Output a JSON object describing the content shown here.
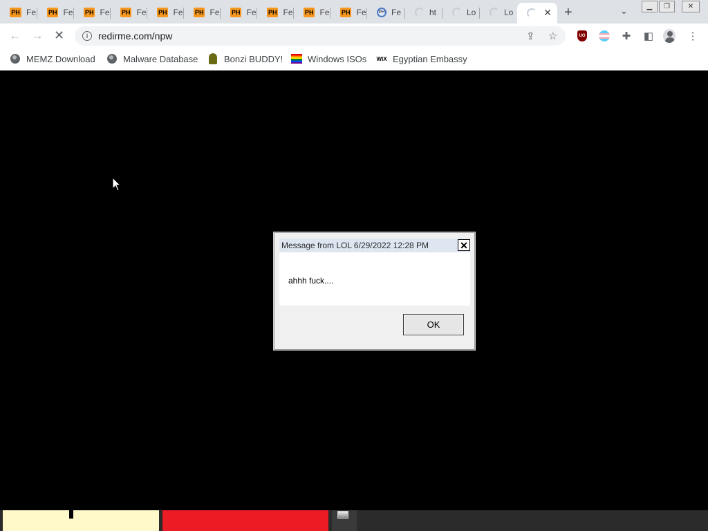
{
  "browser": {
    "tabs": [
      {
        "icon": "PH",
        "title": "Fe"
      },
      {
        "icon": "PH",
        "title": "Fe"
      },
      {
        "icon": "PH",
        "title": "Fe"
      },
      {
        "icon": "PH",
        "title": "Fe"
      },
      {
        "icon": "PH",
        "title": "Fe"
      },
      {
        "icon": "PH",
        "title": "Fe"
      },
      {
        "icon": "PH",
        "title": "Fe"
      },
      {
        "icon": "PH",
        "title": "Fe"
      },
      {
        "icon": "PH",
        "title": "Fe"
      },
      {
        "icon": "PH",
        "title": "Fe"
      },
      {
        "icon": "PH",
        "title": "Fe"
      },
      {
        "icon": "loading-spinner",
        "title": "ht"
      },
      {
        "icon": "loading-spinner",
        "title": "Lo"
      },
      {
        "icon": "loading-spinner",
        "title": "Lo"
      },
      {
        "icon": "loading-spinner",
        "title": ""
      }
    ],
    "active_tab_close": "✕",
    "new_tab": "+",
    "url": "redirme.com/npw"
  },
  "bookmarks": [
    {
      "icon": "globe-icon",
      "label": "MEMZ Download"
    },
    {
      "icon": "globe-icon",
      "label": "Malware Database"
    },
    {
      "icon": "bonzi-icon",
      "label": "Bonzi BUDDY!"
    },
    {
      "icon": "rainbow-flag-icon",
      "label": "Windows ISOs"
    },
    {
      "icon": "wix-icon",
      "label": "Egyptian Embassy"
    }
  ],
  "bookmark_icon_text": {
    "wix": "WIX"
  },
  "extensions": {
    "ublock": "UO"
  },
  "dialog": {
    "title": "Message from LOL 6/29/2022 12:28 PM",
    "message": "ahhh fuck....",
    "ok_label": "OK",
    "close_label": "✕"
  },
  "colors": {
    "page_background": "#000000",
    "ph_icon": "#f7971d",
    "bottom_red": "#ec1c24",
    "bottom_yellow": "#fff8c8"
  }
}
